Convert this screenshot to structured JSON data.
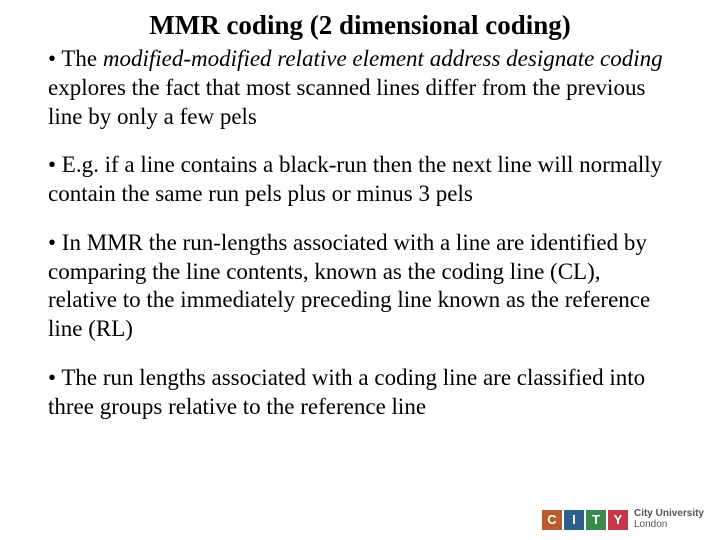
{
  "title": "MMR coding (2 dimensional coding)",
  "bullets": [
    {
      "prefix": "• The ",
      "italic": "modified-modified relative element address designate coding",
      "rest": " explores the fact that most scanned lines differ from the previous line by only a few pels"
    },
    {
      "text": "• E.g. if a line contains a black-run then the next line will normally contain the same run pels plus or minus 3 pels"
    },
    {
      "text": "• In MMR the run-lengths associated with a line are identified by comparing the line contents, known as the coding line (CL), relative to the immediately preceding line known as the reference line (RL)"
    },
    {
      "text": "• The run lengths associated with a coding line are classified into three groups relative to the reference line"
    }
  ],
  "logo": {
    "letters": [
      "C",
      "I",
      "T",
      "Y"
    ],
    "line1": "City University",
    "line2": "London"
  }
}
